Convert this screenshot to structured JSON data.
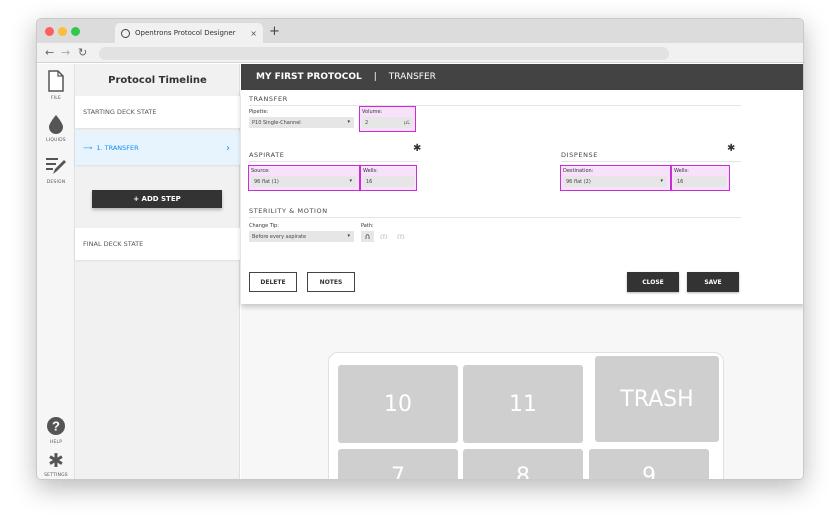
{
  "browser": {
    "tab_title": "Opentrons Protocol Designer",
    "tab_close": "×",
    "new_tab": "+"
  },
  "leftnav": {
    "file": "FILE",
    "liquids": "LIQUIDS",
    "design": "DESIGN",
    "help": "HELP",
    "settings": "SETTINGS"
  },
  "timeline": {
    "title": "Protocol Timeline",
    "starting": "STARTING DECK STATE",
    "step1": "1. TRANSFER",
    "add_step": "+ ADD STEP",
    "final": "FINAL DECK STATE"
  },
  "header": {
    "protocol": "MY FIRST PROTOCOL",
    "separator": "|",
    "step": "TRANSFER"
  },
  "form": {
    "transfer_title": "TRANSFER",
    "pipette_label": "Pipette:",
    "pipette_value": "P10 Single-Channel",
    "volume_label": "Volume:",
    "volume_value": "2",
    "volume_unit": "μL",
    "aspirate_title": "ASPIRATE",
    "source_label": "Source:",
    "source_value": "96 flat (1)",
    "wells_label": "Wells:",
    "source_wells": "16",
    "dispense_title": "DISPENSE",
    "destination_label": "Destination:",
    "destination_value": "96 flat (2)",
    "dest_wells": "16",
    "sterility_title": "STERILITY & MOTION",
    "change_tip_label": "Change Tip:",
    "change_tip_value": "Before every aspirate",
    "path_label": "Path:",
    "delete": "DELETE",
    "notes": "NOTES",
    "close": "CLOSE",
    "save": "SAVE"
  },
  "deck": {
    "slot10": "10",
    "slot11": "11",
    "trash": "TRASH",
    "slot7": "7",
    "slot8": "8",
    "slot9": "9"
  },
  "colors": {
    "highlight": "#c72fd4",
    "active_step": "#0f8ff3",
    "title_bar": "#434343"
  }
}
